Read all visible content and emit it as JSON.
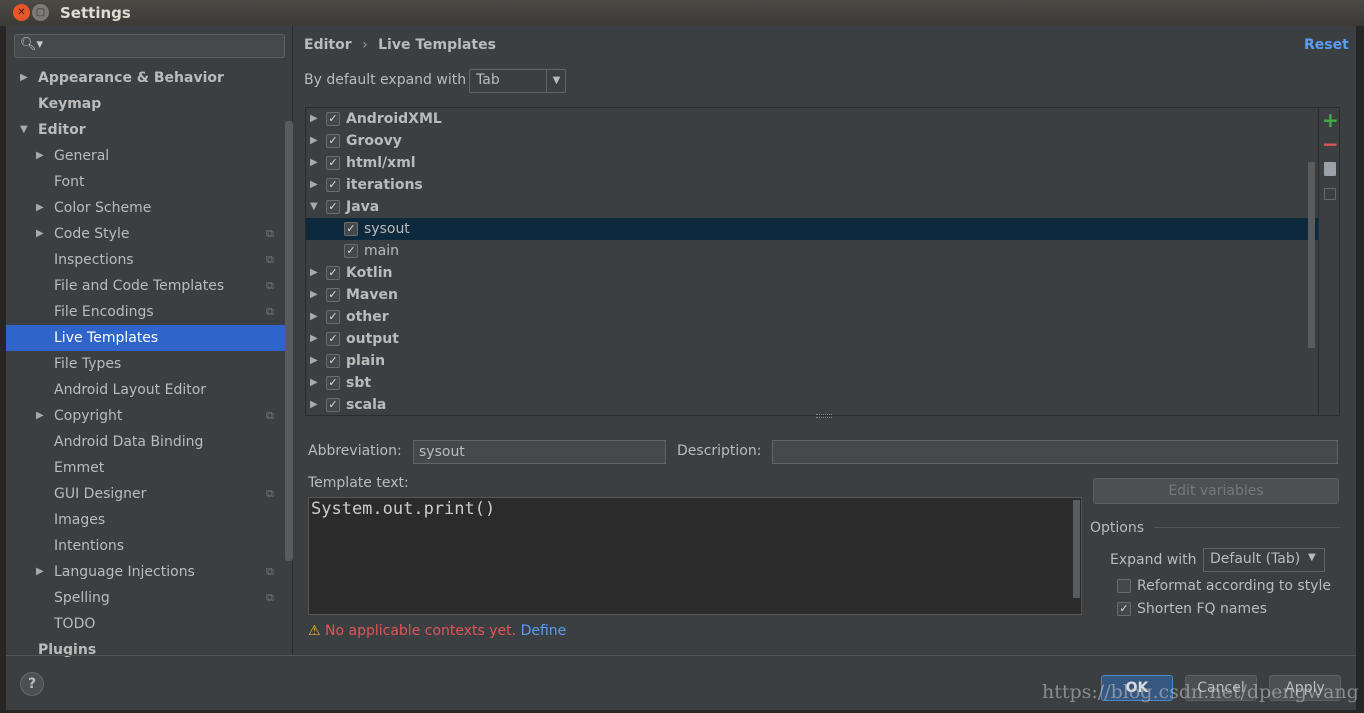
{
  "window": {
    "title": "Settings"
  },
  "sidebar": {
    "items": [
      {
        "label": "Appearance & Behavior",
        "level": 0,
        "arrow": "right",
        "bold": true
      },
      {
        "label": "Keymap",
        "level": 0,
        "bold": true
      },
      {
        "label": "Editor",
        "level": 0,
        "arrow": "down",
        "bold": true
      },
      {
        "label": "General",
        "level": 1,
        "arrow": "right"
      },
      {
        "label": "Font",
        "level": 1
      },
      {
        "label": "Color Scheme",
        "level": 1,
        "arrow": "right"
      },
      {
        "label": "Code Style",
        "level": 1,
        "arrow": "right",
        "copy": true
      },
      {
        "label": "Inspections",
        "level": 1,
        "copy": true
      },
      {
        "label": "File and Code Templates",
        "level": 1,
        "copy": true
      },
      {
        "label": "File Encodings",
        "level": 1,
        "copy": true
      },
      {
        "label": "Live Templates",
        "level": 1,
        "selected": true
      },
      {
        "label": "File Types",
        "level": 1
      },
      {
        "label": "Android Layout Editor",
        "level": 1
      },
      {
        "label": "Copyright",
        "level": 1,
        "arrow": "right",
        "copy": true
      },
      {
        "label": "Android Data Binding",
        "level": 1
      },
      {
        "label": "Emmet",
        "level": 1
      },
      {
        "label": "GUI Designer",
        "level": 1,
        "copy": true
      },
      {
        "label": "Images",
        "level": 1
      },
      {
        "label": "Intentions",
        "level": 1
      },
      {
        "label": "Language Injections",
        "level": 1,
        "arrow": "right",
        "copy": true
      },
      {
        "label": "Spelling",
        "level": 1,
        "copy": true
      },
      {
        "label": "TODO",
        "level": 1
      },
      {
        "label": "Plugins",
        "level": 0,
        "bold": true
      }
    ]
  },
  "breadcrumb": {
    "parent": "Editor",
    "sep": "›",
    "current": "Live Templates"
  },
  "reset": "Reset",
  "expand": {
    "label": "By default expand with",
    "value": "Tab"
  },
  "tree": [
    {
      "label": "AndroidXML",
      "group": true,
      "arrow": "right"
    },
    {
      "label": "Groovy",
      "group": true,
      "arrow": "right"
    },
    {
      "label": "html/xml",
      "group": true,
      "arrow": "right"
    },
    {
      "label": "iterations",
      "group": true,
      "arrow": "right"
    },
    {
      "label": "Java",
      "group": true,
      "arrow": "down"
    },
    {
      "label": "sysout",
      "group": false,
      "selected": true
    },
    {
      "label": "main",
      "group": false
    },
    {
      "label": "Kotlin",
      "group": true,
      "arrow": "right"
    },
    {
      "label": "Maven",
      "group": true,
      "arrow": "right"
    },
    {
      "label": "other",
      "group": true,
      "arrow": "right"
    },
    {
      "label": "output",
      "group": true,
      "arrow": "right"
    },
    {
      "label": "plain",
      "group": true,
      "arrow": "right"
    },
    {
      "label": "sbt",
      "group": true,
      "arrow": "right"
    },
    {
      "label": "scala",
      "group": true,
      "arrow": "right"
    }
  ],
  "toolbar": {
    "add": "+",
    "remove": "−"
  },
  "form": {
    "abbr_label": "Abbreviation:",
    "abbr_value": "sysout",
    "desc_label": "Description:",
    "desc_value": "",
    "template_label": "Template text:",
    "template_value": "System.out.print()",
    "edit_vars": "Edit variables",
    "options": "Options",
    "expand_with_label": "Expand with",
    "expand_with_value": "Default (Tab)",
    "reformat": "Reformat according to style",
    "reformat_checked": false,
    "shorten": "Shorten FQ names",
    "shorten_checked": true,
    "warning": "No applicable contexts yet.",
    "define": "Define"
  },
  "buttons": {
    "ok": "OK",
    "cancel": "Cancel",
    "apply": "Apply",
    "help": "?"
  },
  "watermark": "https://blog.csdn.net/dpengwang",
  "colors": {
    "accent": "#2f65ca",
    "link": "#589df6",
    "error": "#e05555",
    "add": "#40b040"
  }
}
